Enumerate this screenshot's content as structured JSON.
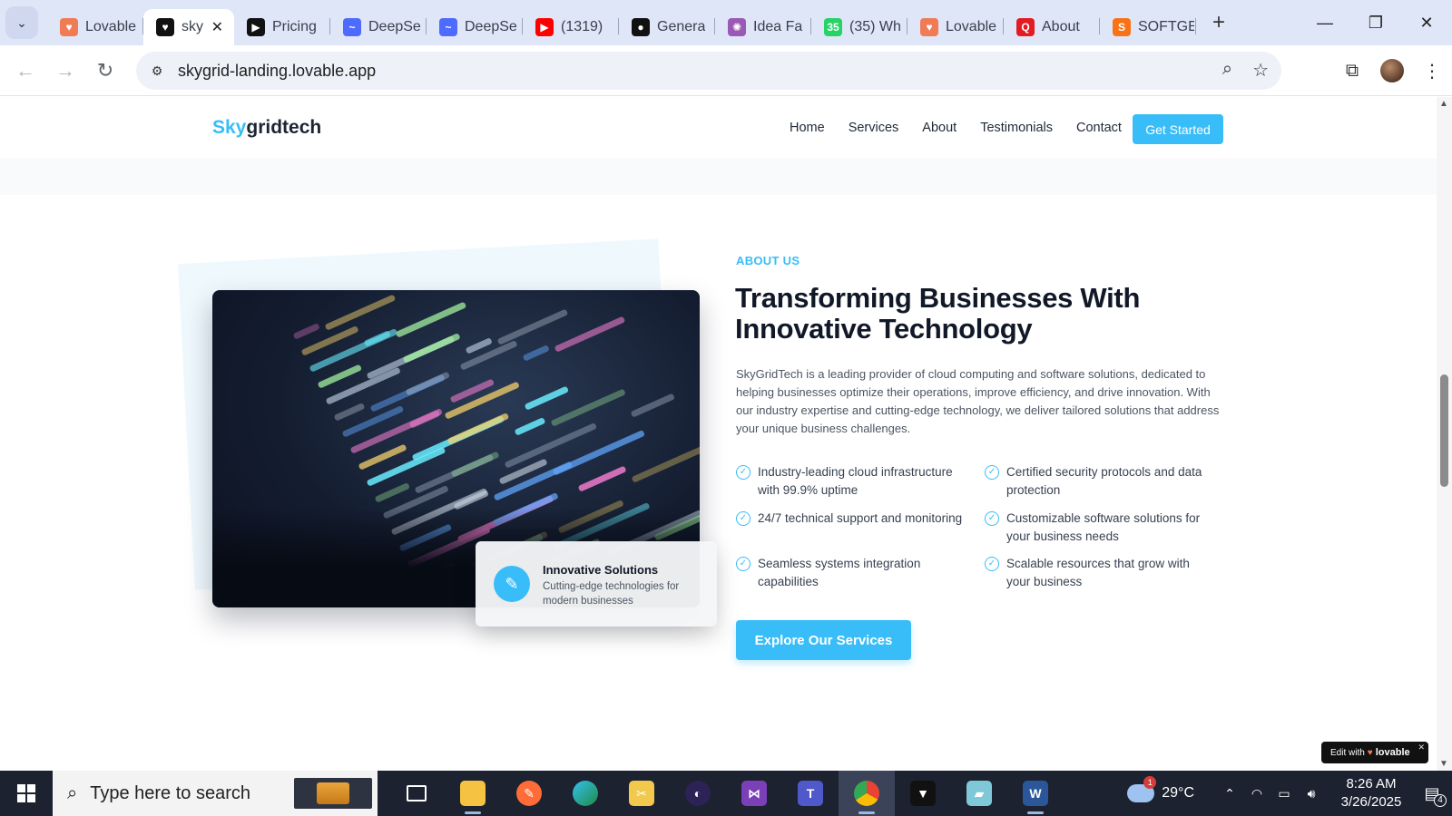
{
  "browser": {
    "tabs": [
      {
        "title": "Lovable",
        "favicon_color": "#f07b54",
        "favicon_glyph": "♥"
      },
      {
        "title": "sky",
        "favicon_color": "#111111",
        "favicon_glyph": "♥",
        "active": true
      },
      {
        "title": "Pricing",
        "favicon_color": "#111111",
        "favicon_glyph": "▶"
      },
      {
        "title": "DeepSe",
        "favicon_color": "#4d6bfe",
        "favicon_glyph": "~"
      },
      {
        "title": "DeepSe",
        "favicon_color": "#4d6bfe",
        "favicon_glyph": "~"
      },
      {
        "title": "(1319)",
        "favicon_color": "#ff0000",
        "favicon_glyph": "▶"
      },
      {
        "title": "Genera",
        "favicon_color": "#111111",
        "favicon_glyph": "●"
      },
      {
        "title": "Idea Fa",
        "favicon_color": "#9b59b6",
        "favicon_glyph": "✺"
      },
      {
        "title": "(35) Wh",
        "favicon_color": "#25d366",
        "favicon_glyph": "35"
      },
      {
        "title": "Lovable",
        "favicon_color": "#f07b54",
        "favicon_glyph": "♥"
      },
      {
        "title": "About",
        "favicon_color": "#e31b23",
        "favicon_glyph": "Q"
      },
      {
        "title": "SOFTGE",
        "favicon_color": "#f97316",
        "favicon_glyph": "S"
      }
    ],
    "url": "skygrid-landing.lovable.app"
  },
  "site": {
    "brand_prefix": "Sky",
    "brand_suffix": "gridtech",
    "nav": [
      "Home",
      "Services",
      "About",
      "Testimonials",
      "Contact"
    ],
    "cta": "Get Started"
  },
  "about": {
    "eyebrow": "ABOUT US",
    "headline_line1": "Transforming Businesses With",
    "headline_line2": "Innovative Technology",
    "paragraph": "SkyGridTech is a leading provider of cloud computing and software solutions, dedicated to helping businesses optimize their operations, improve efficiency, and drive innovation. With our industry expertise and cutting-edge technology, we deliver tailored solutions that address your unique business challenges.",
    "features": [
      "Industry-leading cloud infrastructure with 99.9% uptime",
      "Certified security protocols and data protection",
      "24/7 technical support and monitoring",
      "Customizable software solutions for your business needs",
      "Seamless systems integration capabilities",
      "Scalable resources that grow with your business"
    ],
    "button": "Explore Our Services",
    "badge_title": "Innovative Solutions",
    "badge_subtitle": "Cutting-edge technologies for modern businesses"
  },
  "lovable_badge": {
    "prefix": "Edit with",
    "brand": "lovable"
  },
  "taskbar": {
    "search_placeholder": "Type here to search",
    "weather_temp": "29°C",
    "weather_badge": "1",
    "time": "8:26 AM",
    "date": "3/26/2025",
    "notifications": "4"
  }
}
